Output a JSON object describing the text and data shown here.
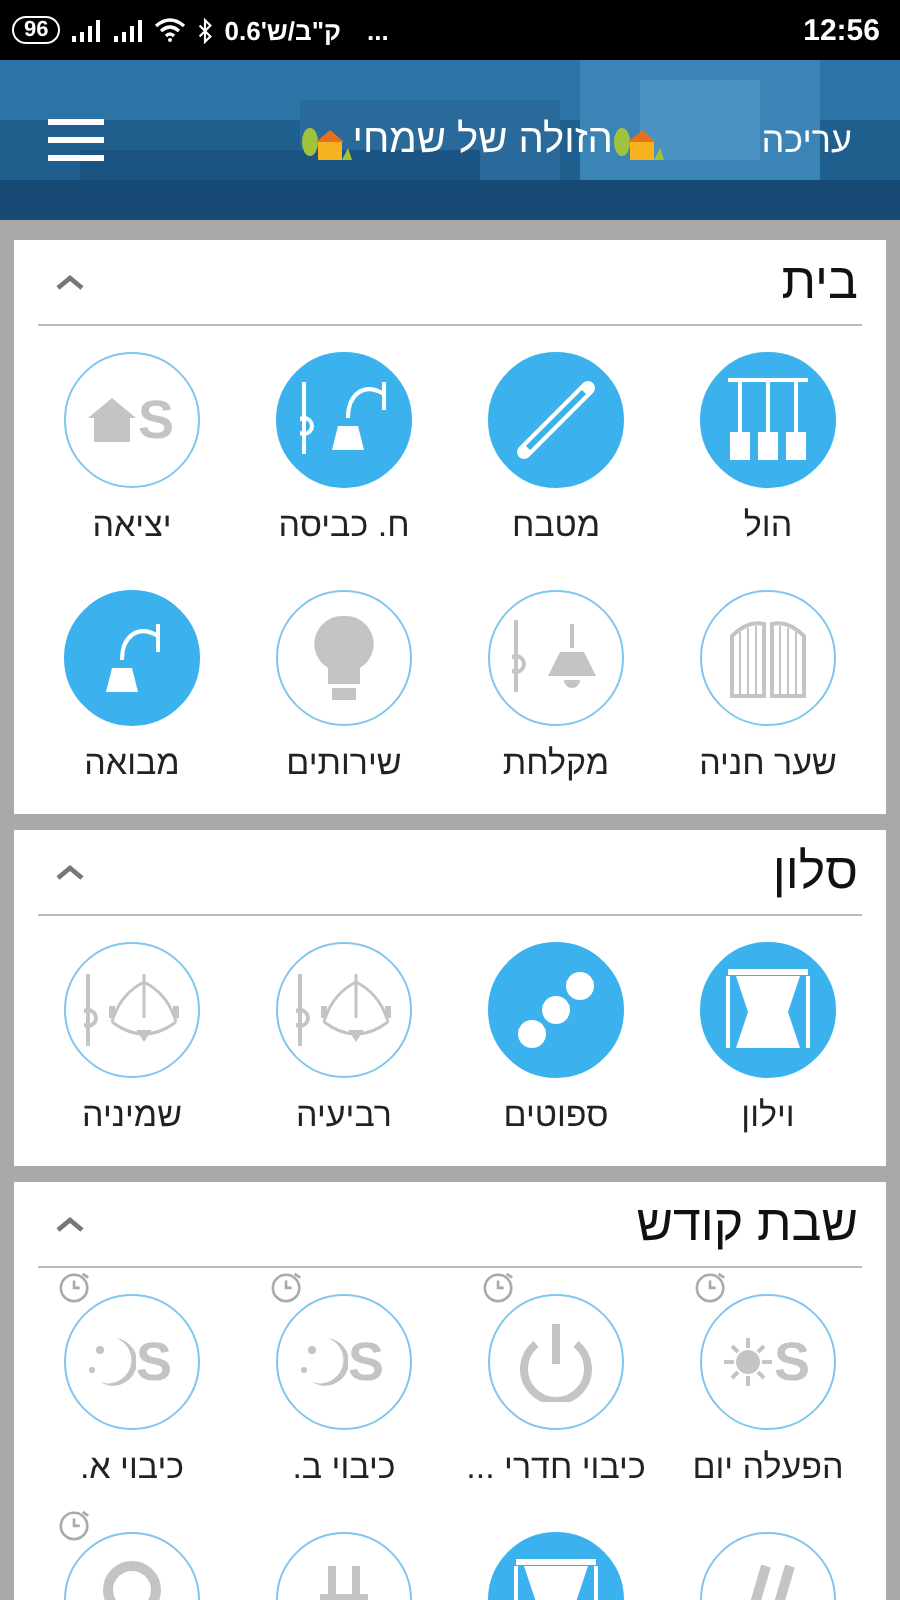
{
  "status_bar": {
    "battery": "96",
    "data_speed": "ק\"ב/ש'0.6",
    "more": "...",
    "time": "12:56"
  },
  "header": {
    "edit": "עריכה",
    "title": "הזולה של שמחי"
  },
  "sections": [
    {
      "title": "בית",
      "expanded": true,
      "tiles": [
        {
          "label": "הול",
          "kind": "pendant",
          "on": true,
          "timer": false
        },
        {
          "label": "מטבח",
          "kind": "tube",
          "on": true,
          "timer": false
        },
        {
          "label": "ח. כביסה",
          "kind": "wall-lamp-switch",
          "on": true,
          "timer": false
        },
        {
          "label": "יציאה",
          "kind": "scene-home",
          "letter": "S",
          "on": false,
          "timer": false
        },
        {
          "label": "שער חניה",
          "kind": "gate",
          "on": false,
          "timer": false
        },
        {
          "label": "מקלחת",
          "kind": "ceiling-lamp-switch",
          "on": false,
          "timer": false
        },
        {
          "label": "שירותים",
          "kind": "bulb",
          "on": false,
          "timer": false
        },
        {
          "label": "מבואה",
          "kind": "wall-lamp",
          "on": true,
          "timer": false
        }
      ]
    },
    {
      "title": "סלון",
      "expanded": true,
      "tiles": [
        {
          "label": "וילון",
          "kind": "curtain",
          "on": true,
          "timer": false
        },
        {
          "label": "ספוטים",
          "kind": "spots",
          "on": true,
          "timer": false
        },
        {
          "label": "רביעיה",
          "kind": "chandelier-switch",
          "on": false,
          "timer": false
        },
        {
          "label": "שמיניה",
          "kind": "chandelier-switch",
          "on": false,
          "timer": false
        }
      ]
    },
    {
      "title": "שבת קודש",
      "expanded": true,
      "tiles": [
        {
          "label": "הפעלה יום",
          "kind": "scene-sun",
          "letter": "S",
          "on": false,
          "timer": true
        },
        {
          "label": "כיבוי חדרי ...",
          "kind": "power",
          "on": false,
          "timer": true
        },
        {
          "label": "כיבוי ב.",
          "kind": "scene-moon",
          "letter": "S",
          "on": false,
          "timer": true
        },
        {
          "label": "כיבוי א.",
          "kind": "scene-moon",
          "letter": "S",
          "on": false,
          "timer": true
        },
        {
          "kind": "slashes",
          "on": false,
          "timer": false
        },
        {
          "kind": "curtain",
          "on": true,
          "timer": false
        },
        {
          "kind": "plug",
          "on": false,
          "timer": false
        },
        {
          "kind": "ring",
          "on": false,
          "timer": true
        }
      ]
    }
  ]
}
